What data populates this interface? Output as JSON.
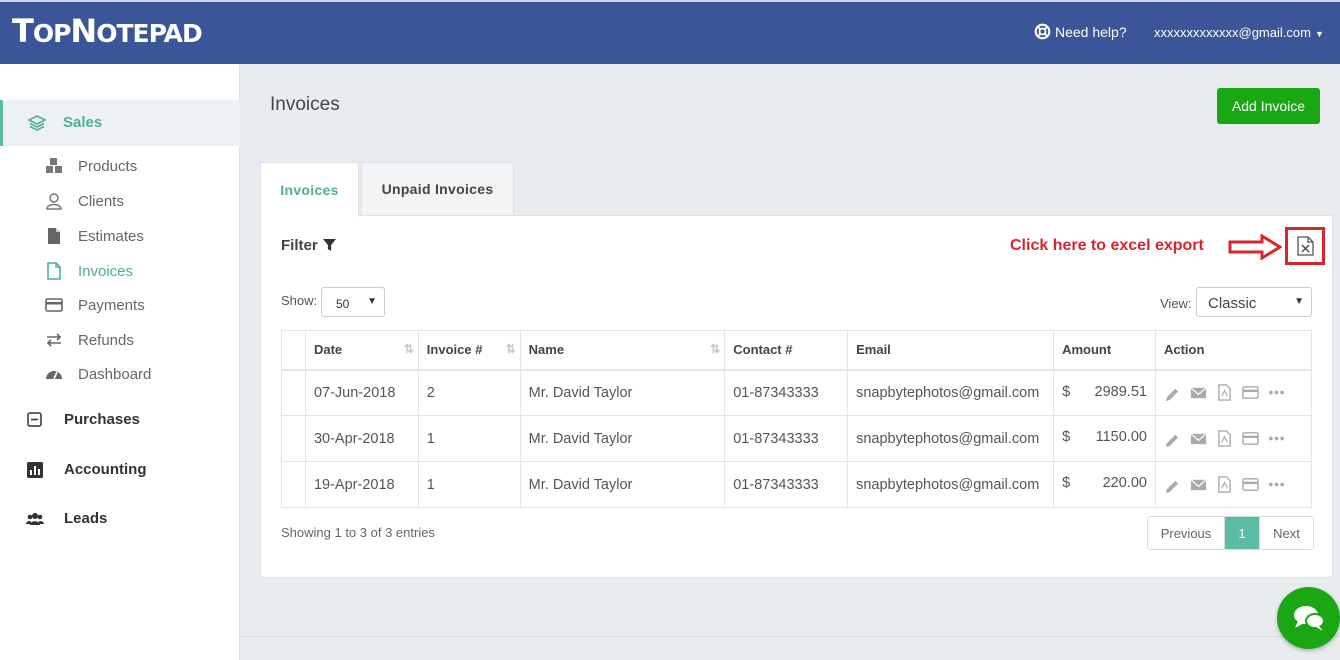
{
  "brand": {
    "logo_first": "T",
    "logo_rest_1": "OP",
    "logo_cap_2": "N",
    "logo_rest_2": "OTEPAD"
  },
  "header": {
    "help_label": "Need help?",
    "user_email": "xxxxxxxxxxxxx@gmail.com"
  },
  "sidebar": {
    "section_label": "Sales",
    "items": [
      {
        "label": "Products",
        "icon": "cubes-icon"
      },
      {
        "label": "Clients",
        "icon": "user-icon"
      },
      {
        "label": "Estimates",
        "icon": "file-icon"
      },
      {
        "label": "Invoices",
        "icon": "file-outline-icon",
        "active": true
      },
      {
        "label": "Payments",
        "icon": "credit-card-icon"
      },
      {
        "label": "Refunds",
        "icon": "exchange-icon"
      },
      {
        "label": "Dashboard",
        "icon": "gauge-icon"
      }
    ],
    "top_items": [
      {
        "label": "Purchases",
        "icon": "minus-square-icon"
      },
      {
        "label": "Accounting",
        "icon": "bar-chart-icon"
      },
      {
        "label": "Leads",
        "icon": "users-icon"
      }
    ]
  },
  "main": {
    "title": "Invoices",
    "add_button": "Add Invoice",
    "tabs": [
      "Invoices",
      "Unpaid Invoices"
    ],
    "filter_label": "Filter",
    "export_note": "Click here to  excel export",
    "show_label": "Show:",
    "show_value": "50",
    "view_label": "View:",
    "view_value": "Classic",
    "columns": [
      "Date",
      "Invoice #",
      "Name",
      "Contact #",
      "Email",
      "Amount",
      "Action"
    ],
    "rows": [
      {
        "date": "07-Jun-2018",
        "invoice": "2",
        "name": "Mr. David Taylor",
        "contact": "01-87343333",
        "email": "snapbytephotos@gmail.com",
        "currency": "$",
        "amount": "2989.51"
      },
      {
        "date": "30-Apr-2018",
        "invoice": "1",
        "name": "Mr. David Taylor",
        "contact": "01-87343333",
        "email": "snapbytephotos@gmail.com",
        "currency": "$",
        "amount": "1150.00"
      },
      {
        "date": "19-Apr-2018",
        "invoice": "1",
        "name": "Mr. David Taylor",
        "contact": "01-87343333",
        "email": "snapbytephotos@gmail.com",
        "currency": "$",
        "amount": "220.00"
      }
    ],
    "info": "Showing 1 to 3 of 3 entries",
    "pager": {
      "prev": "Previous",
      "page": "1",
      "next": "Next"
    }
  },
  "colors": {
    "header": "#3a5598",
    "accent": "#5bbba5",
    "add_button": "#19a814",
    "annotation": "#d9262c"
  }
}
